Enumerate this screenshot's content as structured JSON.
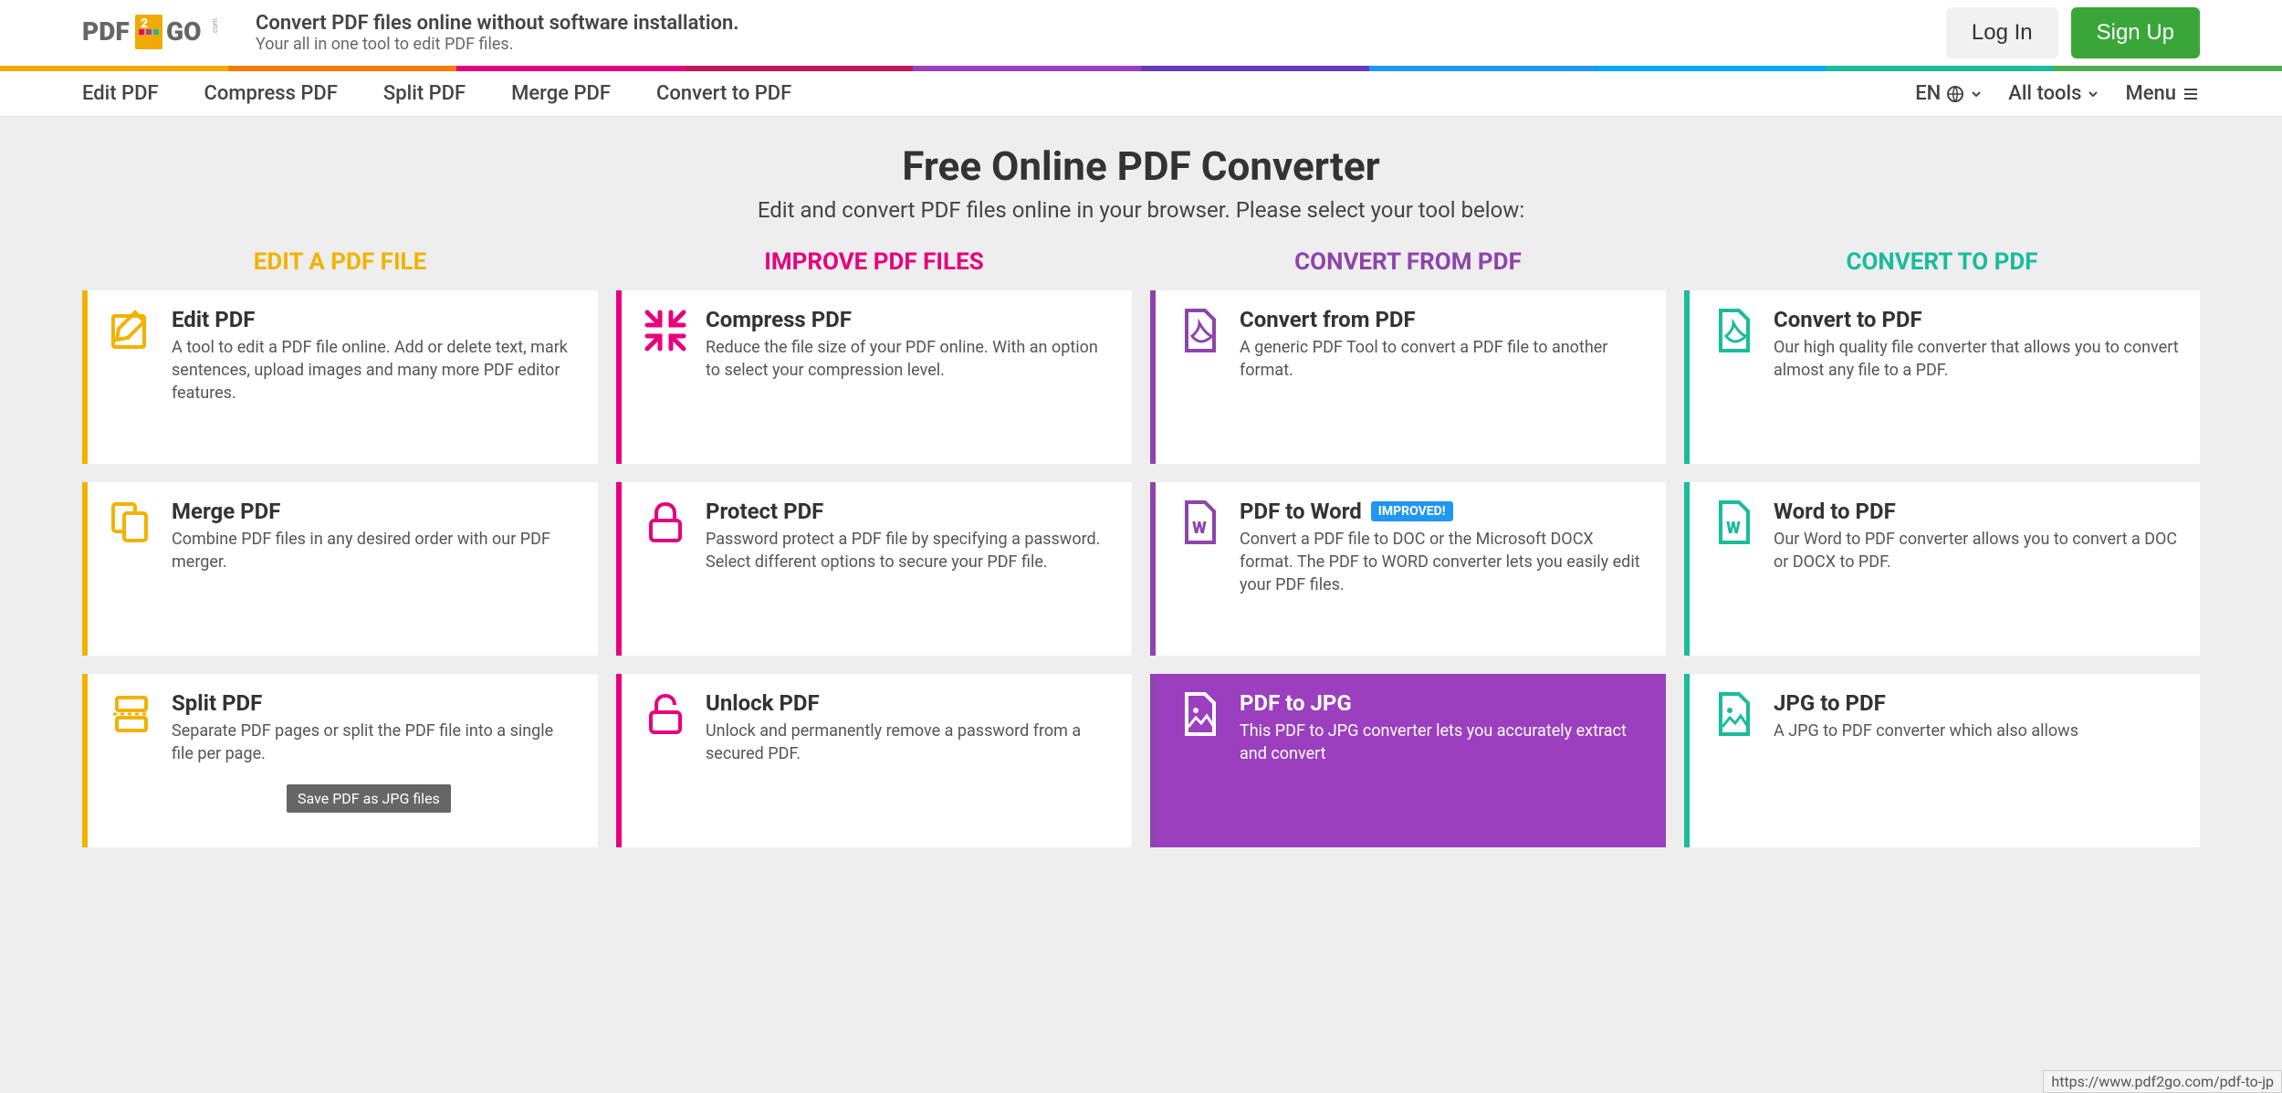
{
  "header": {
    "logo_text": "PDF2GO",
    "tagline_title": "Convert PDF files online without software installation.",
    "tagline_sub": "Your all in one tool to edit PDF files.",
    "login_label": "Log In",
    "signup_label": "Sign Up"
  },
  "rainbow_colors": [
    "#f2a900",
    "#f27d00",
    "#e6007e",
    "#c2185b",
    "#9b3fbf",
    "#673ab7",
    "#2196f3",
    "#03a9f4",
    "#1abc9c",
    "#4caf50"
  ],
  "nav": {
    "items": [
      "Edit PDF",
      "Compress PDF",
      "Split PDF",
      "Merge PDF",
      "Convert to PDF"
    ],
    "lang": "EN",
    "all_tools": "All tools",
    "menu": "Menu"
  },
  "main": {
    "title": "Free Online PDF Converter",
    "subtitle": "Edit and convert PDF files online in your browser. Please select your tool below:"
  },
  "columns": [
    {
      "header": "EDIT A PDF FILE",
      "color_class": "c0",
      "border_class": "b0",
      "cards": [
        {
          "title": "Edit PDF",
          "desc": "A tool to edit a PDF file online. Add or delete text, mark sentences, upload images and many more PDF editor features.",
          "icon": "edit"
        },
        {
          "title": "Merge PDF",
          "desc": "Combine PDF files in any desired order with our PDF merger.",
          "icon": "merge"
        },
        {
          "title": "Split PDF",
          "desc": "Separate PDF pages or split the PDF file into a single file per page.",
          "icon": "split"
        }
      ]
    },
    {
      "header": "IMPROVE PDF FILES",
      "color_class": "c1",
      "border_class": "b1",
      "cards": [
        {
          "title": "Compress PDF",
          "desc": "Reduce the file size of your PDF online. With an option to select your compression level.",
          "icon": "compress"
        },
        {
          "title": "Protect PDF",
          "desc": "Password protect a PDF file by specifying a password. Select different options to secure your PDF file.",
          "icon": "lock"
        },
        {
          "title": "Unlock PDF",
          "desc": "Unlock and permanently remove a password from a secured PDF.",
          "icon": "unlock"
        }
      ]
    },
    {
      "header": "CONVERT FROM PDF",
      "color_class": "c2",
      "border_class": "b2",
      "cards": [
        {
          "title": "Convert from PDF",
          "desc": "A generic PDF Tool to convert a PDF file to another format.",
          "icon": "pdf"
        },
        {
          "title": "PDF to Word",
          "desc": "Convert a PDF file to DOC or the Microsoft DOCX format. The PDF to WORD converter lets you easily edit your PDF files.",
          "icon": "word",
          "badge": "IMPROVED!"
        },
        {
          "title": "PDF to JPG",
          "desc": "This PDF to JPG converter lets you accurately extract and convert",
          "icon": "image",
          "active": true
        }
      ]
    },
    {
      "header": "CONVERT TO PDF",
      "color_class": "c3",
      "border_class": "b3",
      "cards": [
        {
          "title": "Convert to PDF",
          "desc": "Our high quality file converter that allows you to convert almost any file to a PDF.",
          "icon": "pdf"
        },
        {
          "title": "Word to PDF",
          "desc": "Our Word to PDF converter allows you to convert a DOC or DOCX to PDF.",
          "icon": "word"
        },
        {
          "title": "JPG to PDF",
          "desc": "A JPG to PDF converter which also allows",
          "icon": "image"
        }
      ]
    }
  ],
  "tooltip": "Save PDF as JPG files",
  "status_url": "https://www.pdf2go.com/pdf-to-jp"
}
